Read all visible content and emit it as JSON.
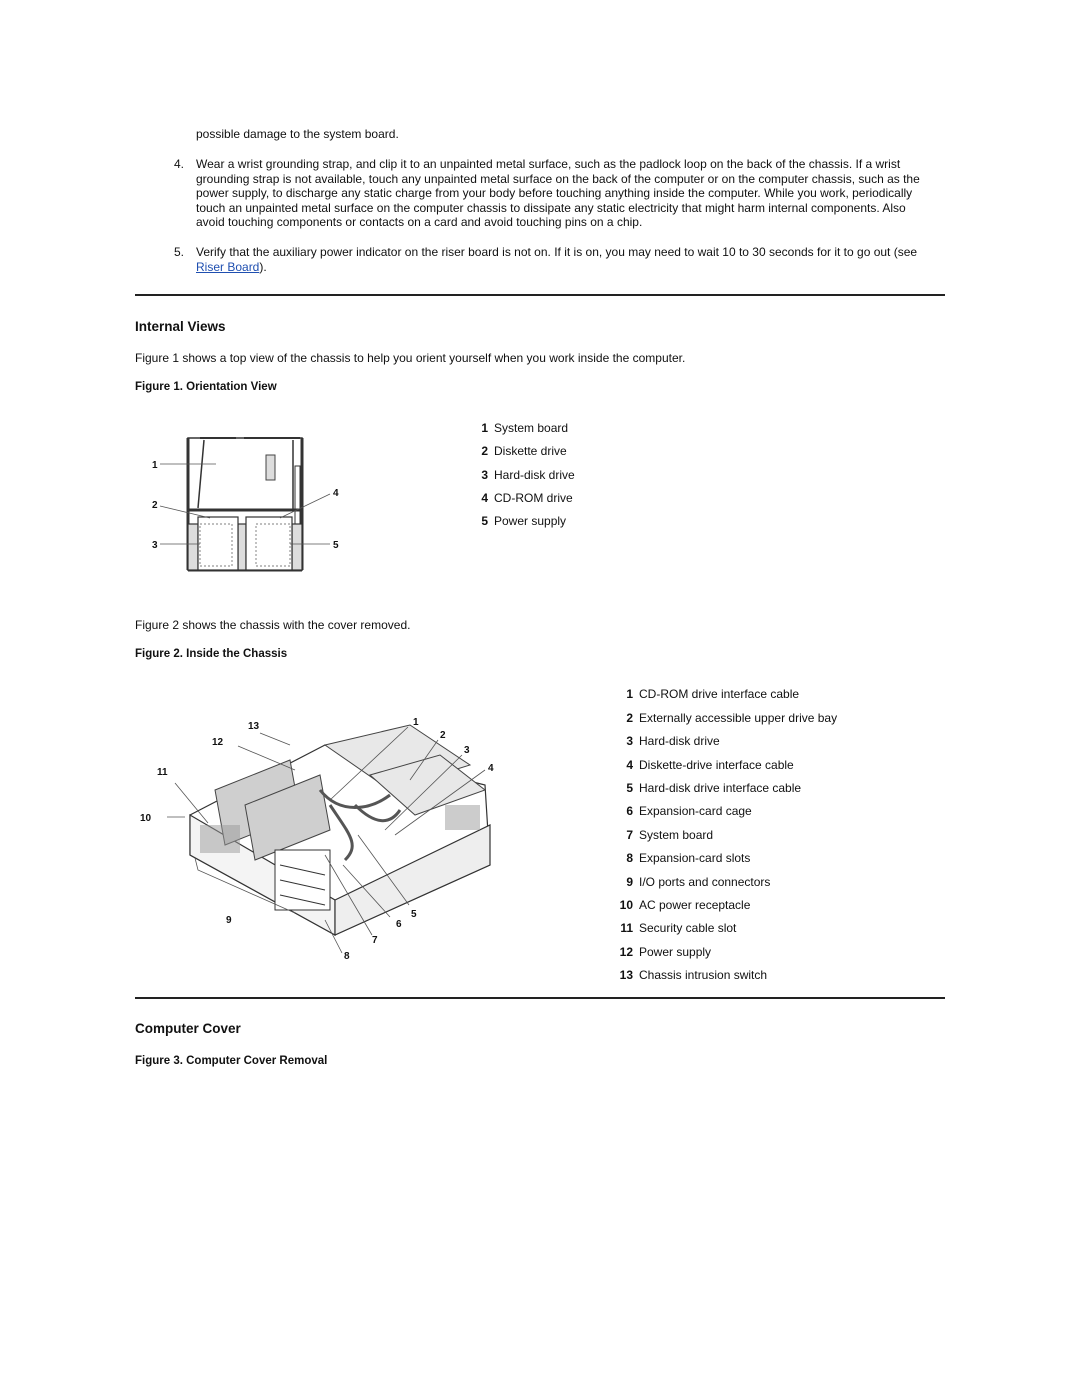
{
  "intro": {
    "continuation": "possible damage to the system board."
  },
  "steps": [
    {
      "number": "4.",
      "text": "Wear a wrist grounding strap, and clip it to an unpainted metal surface, such as the padlock loop on the back of the chassis. If a wrist grounding strap is not available, touch any unpainted metal surface on the back of the computer or on the computer chassis, such as the power supply, to discharge any static charge from your body before touching anything inside the computer.  While you work, periodically touch an unpainted metal surface on the computer chassis to dissipate any static electricity that might harm internal components. Also avoid touching components or contacts on a card and avoid touching pins on a chip."
    },
    {
      "number": "5.",
      "text_before": "Verify that the auxiliary power indicator on the riser board is not on. If it is on, you may need to wait 10 to 30 seconds for it to go out (see ",
      "link": "Riser Board",
      "text_after": ")."
    }
  ],
  "internal_views": {
    "heading": "Internal Views",
    "intro": "Figure 1 shows a top view of the chassis to help you orient yourself when you work inside the computer.",
    "figure1": {
      "caption": "Figure 1. Orientation View",
      "callouts": [
        "1",
        "2",
        "3",
        "4",
        "5"
      ],
      "legend": [
        {
          "n": "1",
          "label": "System board"
        },
        {
          "n": "2",
          "label": "Diskette drive"
        },
        {
          "n": "3",
          "label": "Hard-disk drive"
        },
        {
          "n": "4",
          "label": "CD-ROM drive"
        },
        {
          "n": "5",
          "label": "Power supply"
        }
      ]
    },
    "figure2_intro": "Figure 2 shows the chassis with the cover removed.",
    "figure2": {
      "caption": "Figure 2. Inside the Chassis",
      "callouts": [
        "1",
        "2",
        "3",
        "4",
        "5",
        "6",
        "7",
        "8",
        "9",
        "10",
        "11",
        "12",
        "13"
      ],
      "legend": [
        {
          "n": "1",
          "label": "CD-ROM drive interface cable"
        },
        {
          "n": "2",
          "label": "Externally accessible upper drive bay"
        },
        {
          "n": "3",
          "label": "Hard-disk drive"
        },
        {
          "n": "4",
          "label": "Diskette-drive interface cable"
        },
        {
          "n": "5",
          "label": "Hard-disk drive interface cable"
        },
        {
          "n": "6",
          "label": "Expansion-card cage"
        },
        {
          "n": "7",
          "label": "System board"
        },
        {
          "n": "8",
          "label": "Expansion-card slots"
        },
        {
          "n": "9",
          "label": "I/O ports and connectors"
        },
        {
          "n": "10",
          "label": "AC power receptacle"
        },
        {
          "n": "11",
          "label": "Security cable slot"
        },
        {
          "n": "12",
          "label": "Power supply"
        },
        {
          "n": "13",
          "label": "Chassis intrusion switch"
        }
      ]
    }
  },
  "computer_cover": {
    "heading": "Computer Cover",
    "figure3": {
      "caption": "Figure 3. Computer Cover Removal"
    }
  }
}
